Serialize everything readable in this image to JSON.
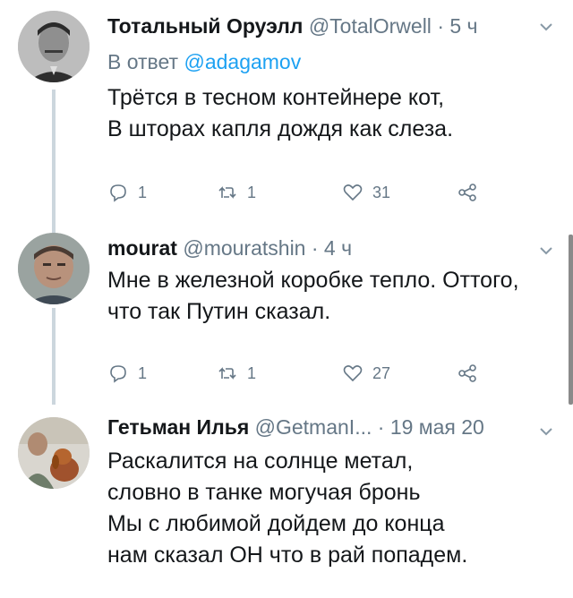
{
  "tweets": [
    {
      "name": "Тотальный Оруэлл",
      "handle": "@TotalOrwell",
      "separator": "·",
      "time": "5 ч",
      "reply_label": "В ответ",
      "reply_mention": "@adagamov",
      "lines": [
        "Трётся в тесном контейнере кот,",
        "В шторах капля дождя как слеза."
      ],
      "replies": "1",
      "retweets": "1",
      "likes": "31"
    },
    {
      "name": "mourat",
      "handle": "@mouratshin",
      "separator": "·",
      "time": "4 ч",
      "lines": [
        "Мне в железной коробке тепло. Оттого,",
        "что так Путин сказал."
      ],
      "replies": "1",
      "retweets": "1",
      "likes": "27"
    },
    {
      "name": "Гетьман Илья",
      "handle": "@GetmanI...",
      "separator": "·",
      "time": "19 мая 20",
      "lines": [
        "Раскалится на солнце метал,",
        "словно в танке могучая бронь",
        "Мы с любимой дойдем до конца",
        "нам сказал ОН что в рай попадем."
      ]
    }
  ],
  "colors": {
    "link": "#1da1f2",
    "secondary_text": "#657786",
    "thread_line": "#ccd6dd"
  }
}
